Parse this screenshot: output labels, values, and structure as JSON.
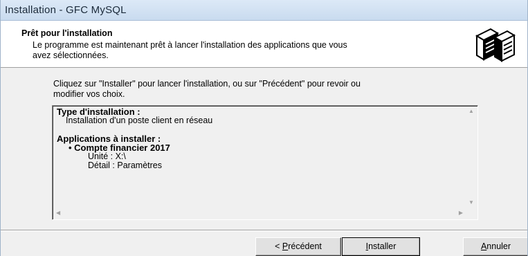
{
  "window": {
    "title": "Installation - GFC MySQL"
  },
  "header": {
    "title": "Prêt pour l'installation",
    "description_line1": "Le programme est maintenant prêt à lancer l'installation des applications que vous",
    "description_line2": "avez sélectionnées.",
    "icon": "computer-install-icon"
  },
  "body": {
    "intro_line1": "Cliquez sur \"Installer\" pour lancer l'installation, ou sur \"Précédent\" pour revoir ou",
    "intro_line2": "modifier vos choix."
  },
  "memo": {
    "type_heading": "Type d'installation :",
    "type_value": "Installation d'un poste client en réseau",
    "apps_heading": "Applications à installer :",
    "apps": [
      {
        "name": "Compte financier 2017",
        "unit": "Unité : X:\\",
        "detail": "Détail : Paramètres"
      }
    ]
  },
  "buttons": {
    "prev_accel": "P",
    "prev_prefix": "< ",
    "prev_rest": "récédent",
    "install_accel": "I",
    "install_rest": "nstaller",
    "cancel_accel": "A",
    "cancel_rest": "nnuler"
  }
}
